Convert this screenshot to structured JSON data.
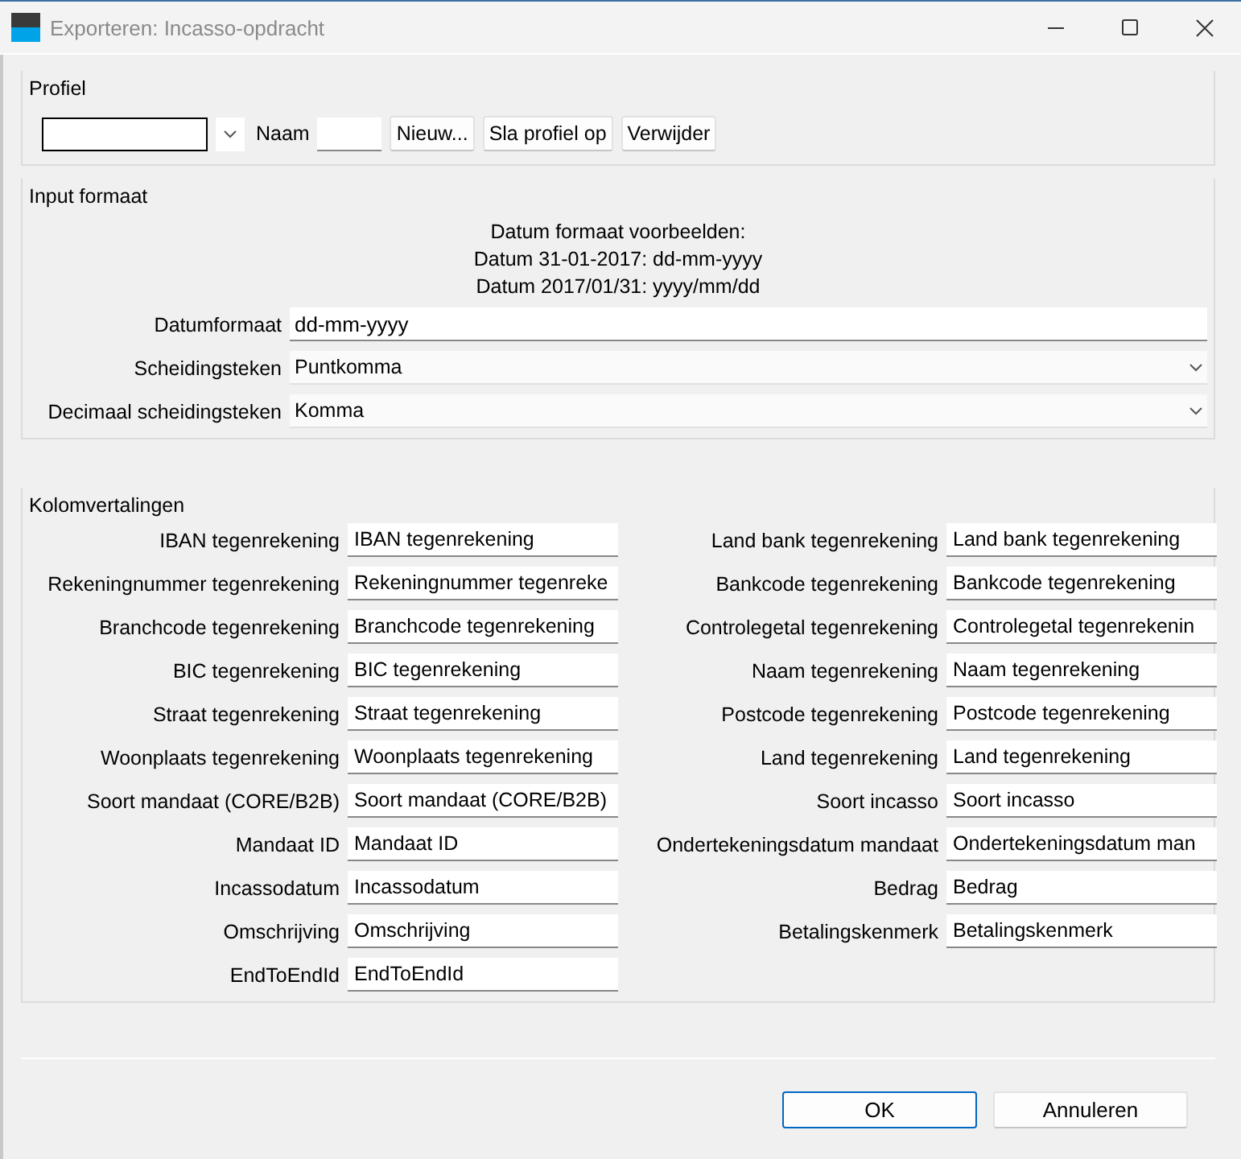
{
  "window": {
    "title": "Exporteren: Incasso-opdracht"
  },
  "profile": {
    "title": "Profiel",
    "name_label": "Naam",
    "buttons": [
      "Nieuw...",
      "Sla profiel op",
      "Verwijder"
    ]
  },
  "input_format": {
    "title": "Input formaat",
    "examples": [
      "Datum formaat voorbeelden:",
      "Datum 31-01-2017: dd-mm-yyyy",
      "Datum 2017/01/31: yyyy/mm/dd"
    ],
    "fields": [
      {
        "label": "Datumformaat",
        "value": "dd-mm-yyyy",
        "kind": "text"
      },
      {
        "label": "Scheidingsteken",
        "value": "Puntkomma",
        "kind": "select"
      },
      {
        "label": "Decimaal scheidingsteken",
        "value": "Komma",
        "kind": "select"
      }
    ]
  },
  "column_translations": {
    "title": "Kolomvertalingen",
    "left": [
      {
        "label": "IBAN tegenrekening",
        "value": "IBAN tegenrekening"
      },
      {
        "label": "Rekeningnummer tegenrekening",
        "value": "Rekeningnummer tegenreke"
      },
      {
        "label": "Branchcode tegenrekening",
        "value": "Branchcode tegenrekening"
      },
      {
        "label": "BIC tegenrekening",
        "value": "BIC tegenrekening"
      },
      {
        "label": "Straat tegenrekening",
        "value": "Straat tegenrekening"
      },
      {
        "label": "Woonplaats tegenrekening",
        "value": "Woonplaats tegenrekening"
      },
      {
        "label": "Soort mandaat (CORE/B2B)",
        "value": "Soort mandaat (CORE/B2B)"
      },
      {
        "label": "Mandaat ID",
        "value": "Mandaat ID"
      },
      {
        "label": "Incassodatum",
        "value": "Incassodatum"
      },
      {
        "label": "Omschrijving",
        "value": "Omschrijving"
      },
      {
        "label": "EndToEndId",
        "value": "EndToEndId"
      }
    ],
    "right": [
      {
        "label": "Land bank tegenrekening",
        "value": "Land bank tegenrekening"
      },
      {
        "label": "Bankcode tegenrekening",
        "value": "Bankcode tegenrekening"
      },
      {
        "label": "Controlegetal tegenrekening",
        "value": "Controlegetal tegenrekenin"
      },
      {
        "label": "Naam tegenrekening",
        "value": "Naam tegenrekening"
      },
      {
        "label": "Postcode tegenrekening",
        "value": "Postcode tegenrekening"
      },
      {
        "label": "Land tegenrekening",
        "value": "Land tegenrekening"
      },
      {
        "label": "Soort incasso",
        "value": "Soort incasso"
      },
      {
        "label": "Ondertekeningsdatum mandaat",
        "value": "Ondertekeningsdatum man"
      },
      {
        "label": "Bedrag",
        "value": "Bedrag"
      },
      {
        "label": "Betalingskenmerk",
        "value": "Betalingskenmerk"
      }
    ]
  },
  "buttons": [
    {
      "label": "OK",
      "default": true
    },
    {
      "label": "Annuleren",
      "default": false
    }
  ]
}
